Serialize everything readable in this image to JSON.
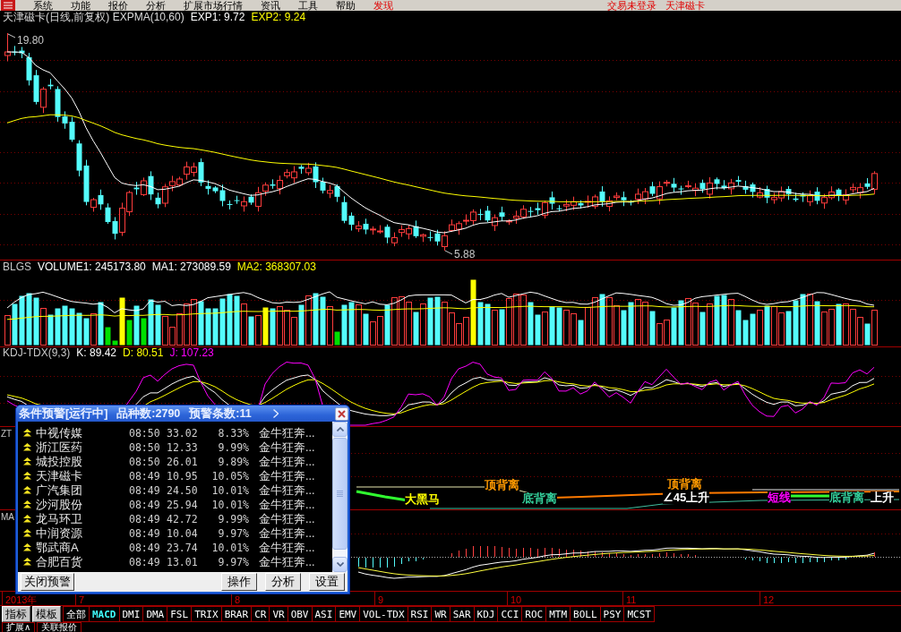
{
  "menu_bar": {
    "items": [
      {
        "label": "系统",
        "kind": "menu"
      },
      {
        "label": "功能",
        "kind": "menu"
      },
      {
        "label": "报价",
        "kind": "menu"
      },
      {
        "label": "分析",
        "kind": "menu"
      },
      {
        "label": "扩展市场行情",
        "kind": "menu"
      },
      {
        "label": "资讯",
        "kind": "menu"
      },
      {
        "label": "工具",
        "kind": "menu"
      },
      {
        "label": "帮助",
        "kind": "menu"
      },
      {
        "label": "发现",
        "kind": "highlight"
      }
    ],
    "status": [
      "交易未登录",
      "天津磁卡"
    ]
  },
  "price_panel": {
    "title": "天津磁卡(日线,前复权) EXPMA(10,60)",
    "values": [
      {
        "text": "EXP1: 9.72",
        "color": "#ffffff"
      },
      {
        "text": "EXP2: 9.24",
        "color": "#ffff00"
      }
    ],
    "high_label": "19.80",
    "low_label": "5.88"
  },
  "volume_panel": {
    "title": "BLGS",
    "values": [
      {
        "text": "VOLUME1: 245173.80",
        "color": "#ffffff"
      },
      {
        "text": "MA1: 273089.59",
        "color": "#ffffff"
      },
      {
        "text": "MA2: 368307.03",
        "color": "#ffff00"
      }
    ]
  },
  "kdj_panel": {
    "title": "KDJ-TDX(9,3)",
    "values": [
      {
        "text": "K: 89.42",
        "color": "#ffffff"
      },
      {
        "text": "D: 80.51",
        "color": "#ffff00"
      },
      {
        "text": "J: 107.23",
        "color": "#ff00ff"
      }
    ]
  },
  "zt_panel": {
    "title": "ZT",
    "signals": [
      {
        "text": "大黑马",
        "color": "#ffff00"
      },
      {
        "text": "顶背离",
        "color": "#ff9900"
      },
      {
        "text": "底背离",
        "color": "#33cc99"
      },
      {
        "text": "顶背离",
        "color": "#ff9900"
      },
      {
        "text": "∠45上升",
        "color": "#ffffff"
      },
      {
        "text": "短线",
        "color": "#ff00ff"
      },
      {
        "text": "底背离",
        "color": "#33cc99"
      },
      {
        "text": "上升",
        "color": "#ffffff"
      }
    ]
  },
  "ma_panel": {
    "title": "MA"
  },
  "date_axis": [
    "2013年",
    "7",
    "8",
    "9",
    "10",
    "11",
    "12"
  ],
  "indicator_bar": {
    "buttons": [
      "指标",
      "模板"
    ],
    "tabs": [
      {
        "label": "全部",
        "selected": false
      },
      {
        "label": "MACD",
        "selected": true
      },
      {
        "label": "DMI",
        "selected": false
      },
      {
        "label": "DMA",
        "selected": false
      },
      {
        "label": "FSL",
        "selected": false
      },
      {
        "label": "TRIX",
        "selected": false
      },
      {
        "label": "BRAR",
        "selected": false
      },
      {
        "label": "CR",
        "selected": false
      },
      {
        "label": "VR",
        "selected": false
      },
      {
        "label": "OBV",
        "selected": false
      },
      {
        "label": "ASI",
        "selected": false
      },
      {
        "label": "EMV",
        "selected": false
      },
      {
        "label": "VOL-TDX",
        "selected": false
      },
      {
        "label": "RSI",
        "selected": false
      },
      {
        "label": "WR",
        "selected": false
      },
      {
        "label": "SAR",
        "selected": false
      },
      {
        "label": "KDJ",
        "selected": false
      },
      {
        "label": "CCI",
        "selected": false
      },
      {
        "label": "ROC",
        "selected": false
      },
      {
        "label": "MTM",
        "selected": false
      },
      {
        "label": "BOLL",
        "selected": false
      },
      {
        "label": "PSY",
        "selected": false
      },
      {
        "label": "MCST",
        "selected": false
      }
    ]
  },
  "bottom_tabs": [
    "扩展∧",
    "关联报价"
  ],
  "alert_dialog": {
    "title": "条件预警[运行中]",
    "stats": [
      "品种数:2790",
      "预警条数:11"
    ],
    "rows": [
      {
        "name": "中视传媒",
        "time": "08:50",
        "price": "33.02",
        "change": "8.33%",
        "signal": "金牛狂奔..."
      },
      {
        "name": "浙江医药",
        "time": "08:50",
        "price": "12.33",
        "change": "9.99%",
        "signal": "金牛狂奔..."
      },
      {
        "name": "城投控股",
        "time": "08:50",
        "price": "26.01",
        "change": "9.89%",
        "signal": "金牛狂奔..."
      },
      {
        "name": "天津磁卡",
        "time": "08:49",
        "price": "10.95",
        "change": "10.05%",
        "signal": "金牛狂奔..."
      },
      {
        "name": "广汽集团",
        "time": "08:49",
        "price": "24.50",
        "change": "10.01%",
        "signal": "金牛狂奔..."
      },
      {
        "name": "沙河股份",
        "time": "08:49",
        "price": "25.94",
        "change": "10.01%",
        "signal": "金牛狂奔..."
      },
      {
        "name": "龙马环卫",
        "time": "08:49",
        "price": "42.72",
        "change": "9.99%",
        "signal": "金牛狂奔..."
      },
      {
        "name": "中润资源",
        "time": "08:49",
        "price": "10.04",
        "change": "9.97%",
        "signal": "金牛狂奔..."
      },
      {
        "name": "鄂武商A",
        "time": "08:49",
        "price": "23.74",
        "change": "10.01%",
        "signal": "金牛狂奔..."
      },
      {
        "name": "合肥百货",
        "time": "08:49",
        "price": "13.01",
        "change": "9.97%",
        "signal": "金牛狂奔..."
      }
    ],
    "buttons_left": [
      "关闭预警"
    ],
    "buttons_right": [
      "操作",
      "分析",
      "设置"
    ]
  }
}
